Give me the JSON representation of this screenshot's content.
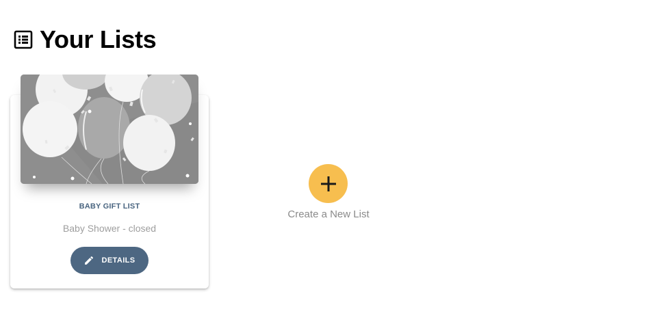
{
  "header": {
    "title": "Your Lists",
    "icon": "list-alt-icon"
  },
  "lists": [
    {
      "title": "BABY GIFT LIST",
      "subtitle": "Baby Shower - closed",
      "image_icon": "balloons-image",
      "details_button": {
        "label": "DETAILS",
        "icon": "pencil-icon"
      }
    }
  ],
  "create_new": {
    "icon": "plus-icon",
    "label": "Create a New List"
  },
  "colors": {
    "fab_accent": "#f7be4f",
    "button_primary": "#4d6782",
    "card_title": "#4a6580",
    "muted_text": "#9e9e9e"
  }
}
